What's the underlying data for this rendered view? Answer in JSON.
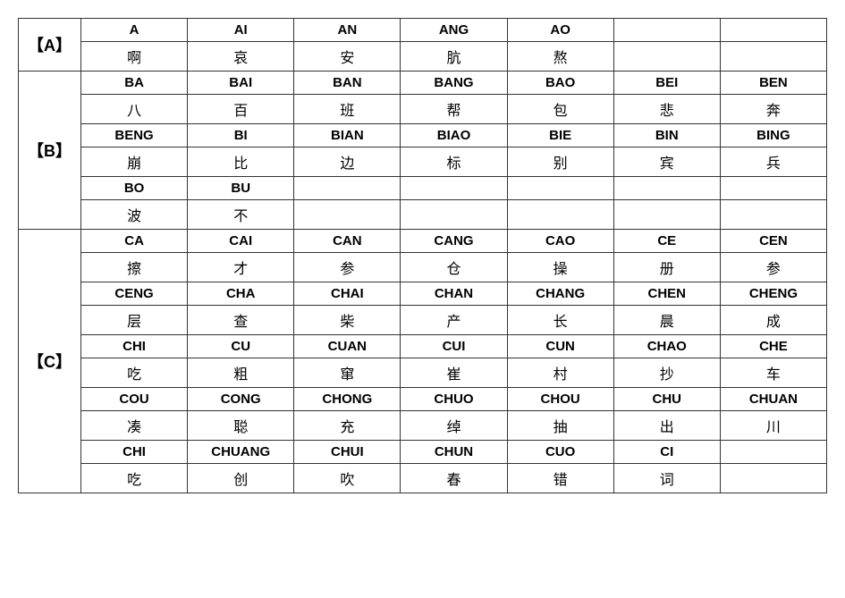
{
  "table": {
    "sections": [
      {
        "label": "【A】",
        "rows": [
          {
            "type": "pinyin",
            "cells": [
              "A",
              "AI",
              "AN",
              "ANG",
              "AO",
              "",
              ""
            ]
          },
          {
            "type": "chinese",
            "cells": [
              "啊",
              "哀",
              "安",
              "肮",
              "熬",
              "",
              ""
            ]
          }
        ]
      },
      {
        "label": "【B】",
        "rows": [
          {
            "type": "pinyin",
            "cells": [
              "BA",
              "BAI",
              "BAN",
              "BANG",
              "BAO",
              "BEI",
              "BEN"
            ]
          },
          {
            "type": "chinese",
            "cells": [
              "八",
              "百",
              "班",
              "帮",
              "包",
              "悲",
              "奔"
            ]
          },
          {
            "type": "pinyin",
            "cells": [
              "BENG",
              "BI",
              "BIAN",
              "BIAO",
              "BIE",
              "BIN",
              "BING"
            ]
          },
          {
            "type": "chinese",
            "cells": [
              "崩",
              "比",
              "边",
              "标",
              "别",
              "宾",
              "兵"
            ]
          },
          {
            "type": "pinyin",
            "cells": [
              "BO",
              "BU",
              "",
              "",
              "",
              "",
              ""
            ]
          },
          {
            "type": "chinese",
            "cells": [
              "波",
              "不",
              "",
              "",
              "",
              "",
              ""
            ]
          }
        ]
      },
      {
        "label": "【C】",
        "rows": [
          {
            "type": "pinyin",
            "cells": [
              "CA",
              "CAI",
              "CAN",
              "CANG",
              "CAO",
              "CE",
              "CEN"
            ]
          },
          {
            "type": "chinese",
            "cells": [
              "擦",
              "才",
              "参",
              "仓",
              "操",
              "册",
              "参"
            ]
          },
          {
            "type": "pinyin",
            "cells": [
              "CENG",
              "CHA",
              "CHAI",
              "CHAN",
              "CHANG",
              "CHEN",
              "CHENG"
            ]
          },
          {
            "type": "chinese",
            "cells": [
              "层",
              "查",
              "柴",
              "产",
              "长",
              "晨",
              "成"
            ]
          },
          {
            "type": "pinyin",
            "cells": [
              "CHI",
              "CU",
              "CUAN",
              "CUI",
              "CUN",
              "CHAO",
              "CHE"
            ]
          },
          {
            "type": "chinese",
            "cells": [
              "吃",
              "粗",
              "窜",
              "崔",
              "村",
              "抄",
              "车"
            ]
          },
          {
            "type": "pinyin",
            "cells": [
              "COU",
              "CONG",
              "CHONG",
              "CHUO",
              "CHOU",
              "CHU",
              "CHUAN"
            ]
          },
          {
            "type": "chinese",
            "cells": [
              "凑",
              "聪",
              "充",
              "绰",
              "抽",
              "出",
              "川"
            ]
          },
          {
            "type": "pinyin",
            "cells": [
              "CHI",
              "CHUANG",
              "CHUI",
              "CHUN",
              "CUO",
              "CI",
              ""
            ]
          },
          {
            "type": "chinese",
            "cells": [
              "吃",
              "创",
              "吹",
              "春",
              "错",
              "词",
              ""
            ]
          }
        ]
      }
    ]
  }
}
